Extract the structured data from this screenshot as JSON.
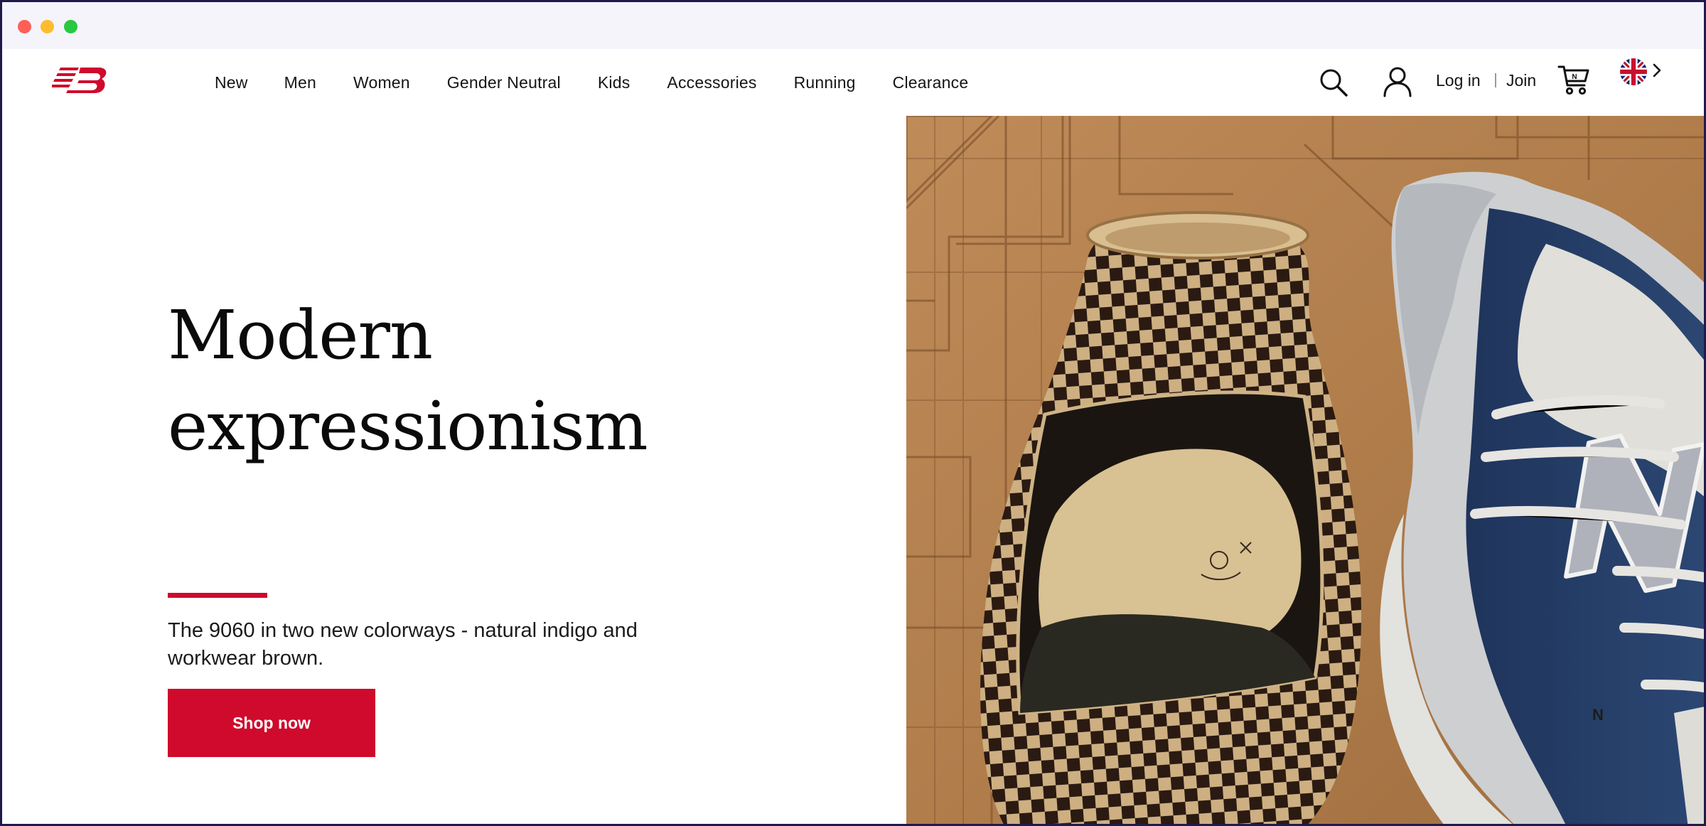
{
  "window": {
    "controls": [
      "close",
      "minimize",
      "maximize"
    ]
  },
  "brand": {
    "logo": "new-balance-logo",
    "accent_color": "#cf0a2c"
  },
  "nav": {
    "items": [
      "New",
      "Men",
      "Women",
      "Gender Neutral",
      "Kids",
      "Accessories",
      "Running",
      "Clearance"
    ]
  },
  "account": {
    "login_label": "Log in",
    "join_label": "Join",
    "search_icon": "search-icon",
    "user_icon": "user-icon",
    "cart_icon": "cart-icon",
    "locale_icon": "uk-flag-icon"
  },
  "hero": {
    "headline_line1": "Modern",
    "headline_line2": "expressionism",
    "subcopy": "The 9060 in two new colorways - natural indigo and workwear brown.",
    "cta_label": "Shop now",
    "image": "checkered-vase-and-blue-sneaker-on-parquet-floor"
  }
}
